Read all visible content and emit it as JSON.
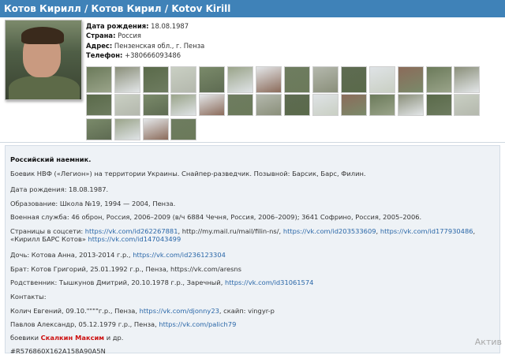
{
  "header": {
    "title": "Котов Кирилл / Котов Кирил / Kotov Kirill"
  },
  "info": [
    {
      "label": "Дата рождения:",
      "value": "18.08.1987"
    },
    {
      "label": "Страна:",
      "value": "Россия"
    },
    {
      "label": "Адрес:",
      "value": "Пензенская обл., г. Пенза"
    },
    {
      "label": "Телефон:",
      "value": "+380666093486"
    }
  ],
  "content": {
    "heading": "Российский наемник.",
    "line1": "Боевик НВФ («Легион») на территории Украины. Снайпер-разведчик. Позывной: Барсик, Барс, Филин.",
    "line2": "Дата рождения: 18.08.1987.",
    "line3": "Образование:  Школа №19, 1994 — 2004, Пенза.",
    "line4": "Военная служба: 46 оброн, Россия, 2006–2009 (в/ч 6884 Чечня, Россия, 2006–2009); 3641 Софрино, Россия, 2005–2006.",
    "social_prefix": "Страницы в соцсети: ",
    "social_link1": "https://vk.com/id262267881",
    "social_sep1": ",  http://my.mail.ru/mail/filin-ns/, ",
    "social_link2": "https://vk.com/id203533609",
    "social_sep2": ", ",
    "social_link3": "https://vk.com/id177930486",
    "social_sep3": ",",
    "social_line2_prefix": "«Кирилл БАРС Котов» ",
    "social_link4": "https://vk.com/id147043499",
    "daughter_prefix": "Дочь: Котова Анна, 2013-2014 г.р., ",
    "daughter_link": "https://vk.com/id236123304",
    "brother_text": "Брат: Котов Григорий, 25.01.1992 г.р., Пенза,  https://vk.com/aresns",
    "relative_prefix": "Родственник: Тышкунов Дмитрий, 20.10.1978 г.р., Заречный, ",
    "relative_link": "https://vk.com/id31061574",
    "contacts": "Контакты:",
    "contact1_prefix": "Колич Евгений, 09.10.\"\"\"\"г.р., Пенза, ",
    "contact1_link": "https://vk.com/djonny23",
    "contact1_suffix": ", скайп: vingyr-p",
    "contact2_prefix": "Павлов Александр, 05.12.1979 г.р., Пенза, ",
    "contact2_link": "https://vk.com/palich79",
    "fighters_prefix": "боевики ",
    "fighters_name": "Скалкин Максим",
    "fighters_suffix": " и др.",
    "code": "#R576860X162A158A90A5N"
  },
  "watermark": "Актив"
}
